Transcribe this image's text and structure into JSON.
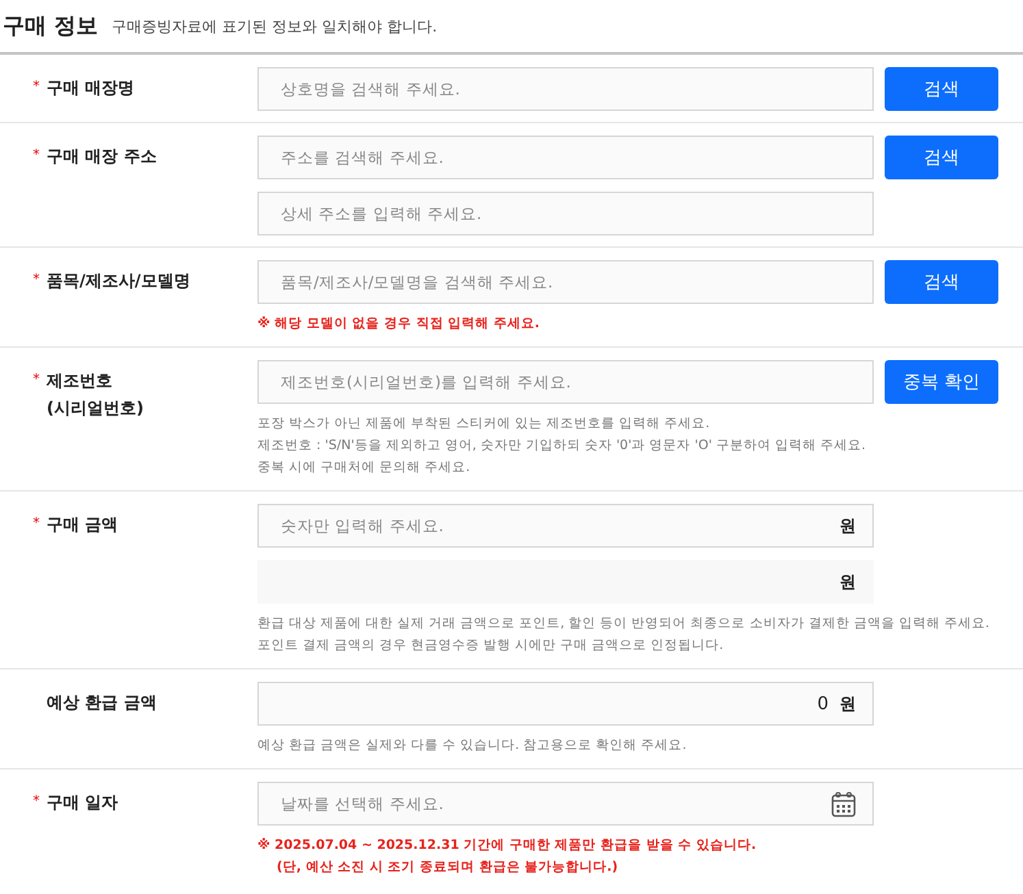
{
  "header": {
    "title": "구매 정보",
    "subtitle": "구매증빙자료에 표기된 정보와 일치해야 합니다."
  },
  "required_mark": "*",
  "rows": [
    {
      "label_lines": [
        "구매 매장명"
      ],
      "required": true,
      "fields": [
        {
          "kind": "text",
          "placeholder": "상호명을 검색해 주세요.",
          "button": "검색"
        }
      ],
      "notes": []
    },
    {
      "label_lines": [
        "구매 매장 주소"
      ],
      "required": true,
      "fields": [
        {
          "kind": "text",
          "placeholder": "주소를 검색해 주세요.",
          "button": "검색"
        },
        {
          "kind": "text",
          "placeholder": "상세 주소를 입력해 주세요."
        }
      ],
      "notes": []
    },
    {
      "label_lines": [
        "품목/제조사/모델명"
      ],
      "required": true,
      "fields": [
        {
          "kind": "text",
          "placeholder": "품목/제조사/모델명을 검색해 주세요.",
          "button": "검색"
        }
      ],
      "notes": [
        {
          "kind": "warning",
          "lines": [
            "※ 해당 모델이 없을 경우 직접 입력해 주세요."
          ]
        }
      ]
    },
    {
      "label_lines": [
        "제조번호",
        "(시리얼번호)"
      ],
      "required": true,
      "fields": [
        {
          "kind": "text",
          "placeholder": "제조번호(시리얼번호)를 입력해 주세요.",
          "button": "중복 확인"
        }
      ],
      "notes": [
        {
          "kind": "help",
          "lines": [
            "포장 박스가 아닌 제품에 부착된 스티커에 있는 제조번호를 입력해 주세요.",
            "제조번호 : 'S/N'등을 제외하고 영어, 숫자만 기입하되 숫자 '0'과 영문자 'O' 구분하여 입력해 주세요.",
            "중복 시에 구매처에 문의해 주세요."
          ]
        }
      ]
    },
    {
      "label_lines": [
        "구매 금액"
      ],
      "required": true,
      "fields": [
        {
          "kind": "amount",
          "placeholder": "숫자만 입력해 주세요.",
          "unit": "원"
        },
        {
          "kind": "amount",
          "unit": "원",
          "disabled": true
        }
      ],
      "notes": [
        {
          "kind": "help",
          "lines": [
            "환급 대상 제품에 대한 실제 거래 금액으로 포인트, 할인 등이 반영되어 최종으로 소비자가 결제한 금액을 입력해 주세요.",
            "포인트 결제 금액의 경우 현금영수증 발행 시에만 구매 금액으로 인정됩니다."
          ]
        }
      ]
    },
    {
      "label_lines": [
        "예상 환급 금액"
      ],
      "required": false,
      "fields": [
        {
          "kind": "amount",
          "value": "0",
          "unit": "원"
        }
      ],
      "notes": [
        {
          "kind": "help",
          "lines": [
            "예상 환급 금액은 실제와 다를 수 있습니다. 참고용으로 확인해 주세요."
          ]
        }
      ]
    },
    {
      "label_lines": [
        "구매 일자"
      ],
      "required": true,
      "fields": [
        {
          "kind": "date",
          "placeholder": "날짜를 선택해 주세요."
        }
      ],
      "notes": [
        {
          "kind": "warning",
          "lines": [
            "※ 2025.07.04 ~ 2025.12.31 기간에 구매한 제품만 환급을 받을 수 있습니다.",
            "(단, 예산 소진 시 조기 종료되며 환급은 불가능합니다.)"
          ]
        }
      ]
    }
  ]
}
